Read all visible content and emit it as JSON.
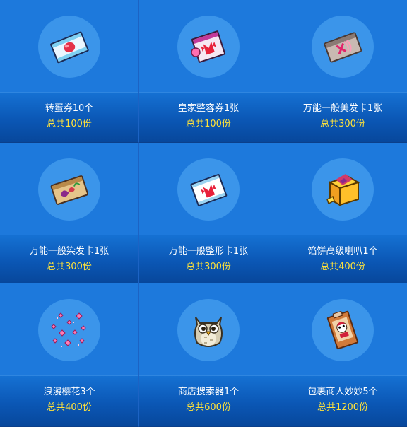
{
  "items": [
    {
      "name": "转蛋券10个",
      "price": "总共100份",
      "icon": "capsule-ticket-icon"
    },
    {
      "name": "皇家整容券1张",
      "price": "总共100份",
      "icon": "royal-face-coupon-icon"
    },
    {
      "name": "万能一般美发卡1张",
      "price": "总共300份",
      "icon": "hair-style-card-icon"
    },
    {
      "name": "万能一般染发卡1张",
      "price": "总共300份",
      "icon": "hair-dye-card-icon"
    },
    {
      "name": "万能一般整形卡1张",
      "price": "总共300份",
      "icon": "face-surgery-card-icon"
    },
    {
      "name": "馅饼高级喇叭1个",
      "price": "总共400份",
      "icon": "pie-megaphone-box-icon"
    },
    {
      "name": "浪漫樱花3个",
      "price": "总共400份",
      "icon": "cherry-blossom-sparkle-icon"
    },
    {
      "name": "商店搜索器1个",
      "price": "总共600份",
      "icon": "owl-store-search-icon"
    },
    {
      "name": "包裹商人妙妙5个",
      "price": "总共1200份",
      "icon": "package-merchant-card-icon"
    }
  ],
  "colors": {
    "name_text": "#ffffff",
    "price_text": "#ffe23a",
    "tile_top": "#1d79dc",
    "icon_circle": "#3b95ea"
  }
}
